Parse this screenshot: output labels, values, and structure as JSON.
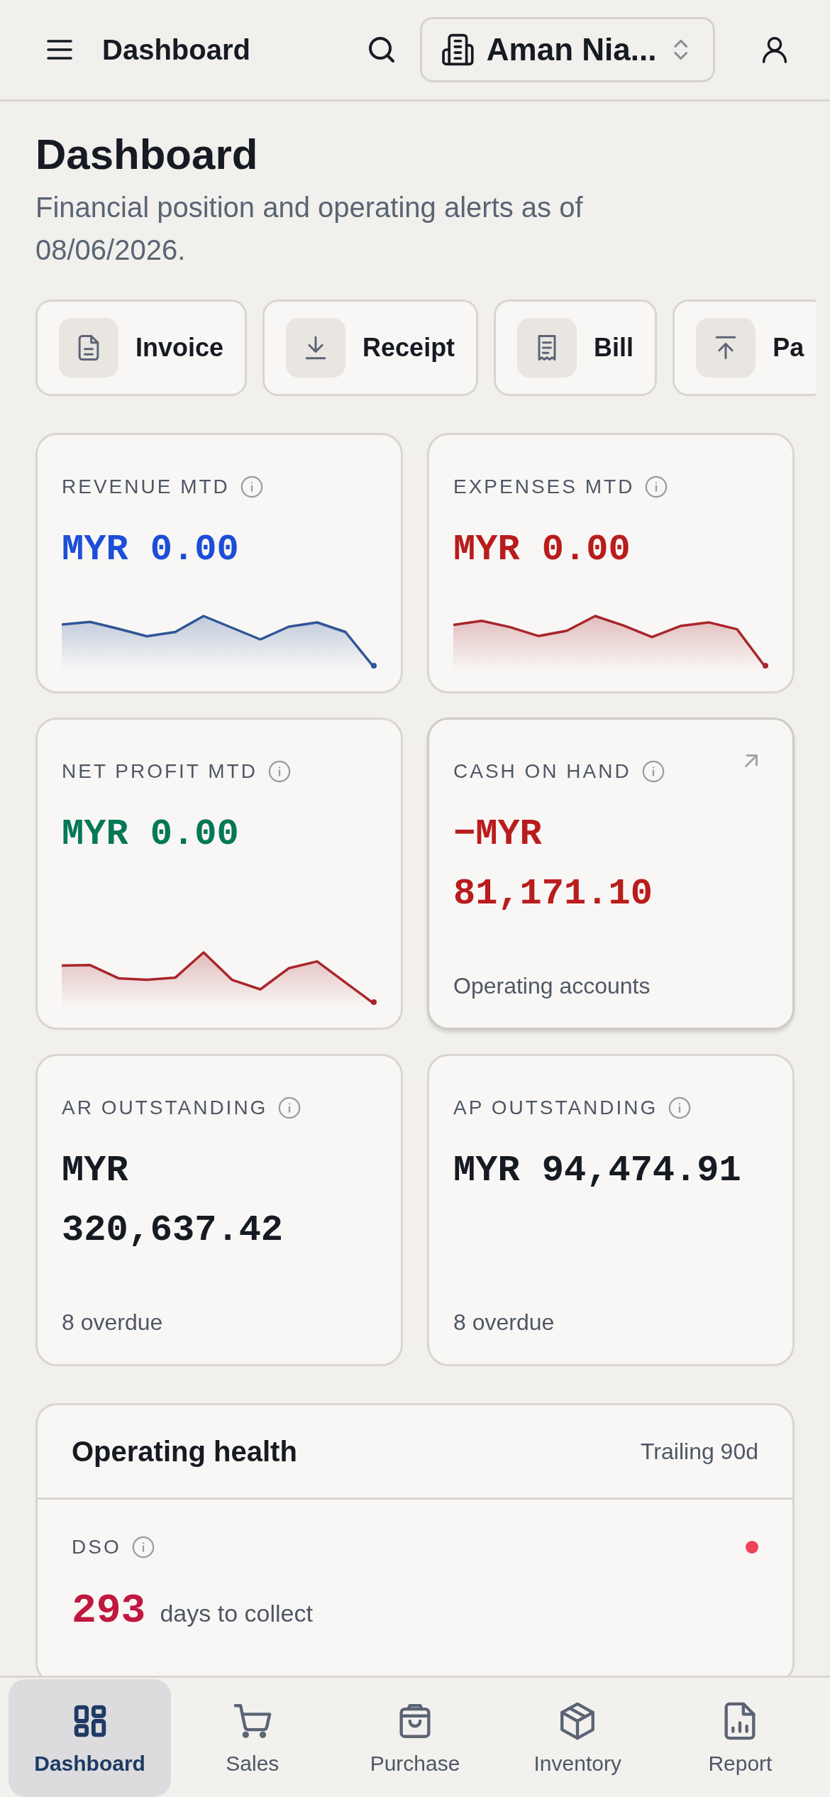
{
  "top_bar": {
    "title": "Dashboard",
    "organization": "Aman Nia..."
  },
  "header": {
    "title": "Dashboard",
    "subtitle": "Financial position and operating alerts as of 08/06/2026."
  },
  "quick_actions": [
    {
      "label": "Invoice"
    },
    {
      "label": "Receipt"
    },
    {
      "label": "Bill"
    },
    {
      "label": "Pa"
    }
  ],
  "cards": [
    {
      "kind": "sparkline",
      "label": "REVENUE MTD",
      "value": "MYR 0.00",
      "color": "#1d4ed8"
    },
    {
      "kind": "sparkline",
      "label": "EXPENSES MTD",
      "value": "MYR 0.00",
      "color": "#b91c1c"
    },
    {
      "kind": "sparkline",
      "label": "NET PROFIT MTD",
      "value": "MYR 0.00",
      "color": "#047857"
    },
    {
      "kind": "link",
      "label": "CASH ON HAND",
      "value": "−MYR 81,171.10",
      "color": "#b91c1c",
      "note": "Operating accounts"
    },
    {
      "kind": "plain",
      "label": "AR OUTSTANDING",
      "value": "MYR 320,637.42",
      "color": "#161a22",
      "note": "8 overdue"
    },
    {
      "kind": "plain",
      "label": "AP OUTSTANDING",
      "value": "MYR 94,474.91",
      "color": "#161a22",
      "note": "8 overdue"
    }
  ],
  "operating_health": {
    "title": "Operating health",
    "period": "Trailing 90d",
    "metrics": [
      {
        "label": "DSO",
        "value": "293",
        "unit": "days to collect",
        "color": "#f0435a"
      }
    ]
  },
  "bottom_nav": [
    {
      "label": "Dashboard",
      "selected": true
    },
    {
      "label": "Sales",
      "selected": false
    },
    {
      "label": "Purchase",
      "selected": false
    },
    {
      "label": "Inventory",
      "selected": false
    },
    {
      "label": "Report",
      "selected": false
    }
  ]
}
